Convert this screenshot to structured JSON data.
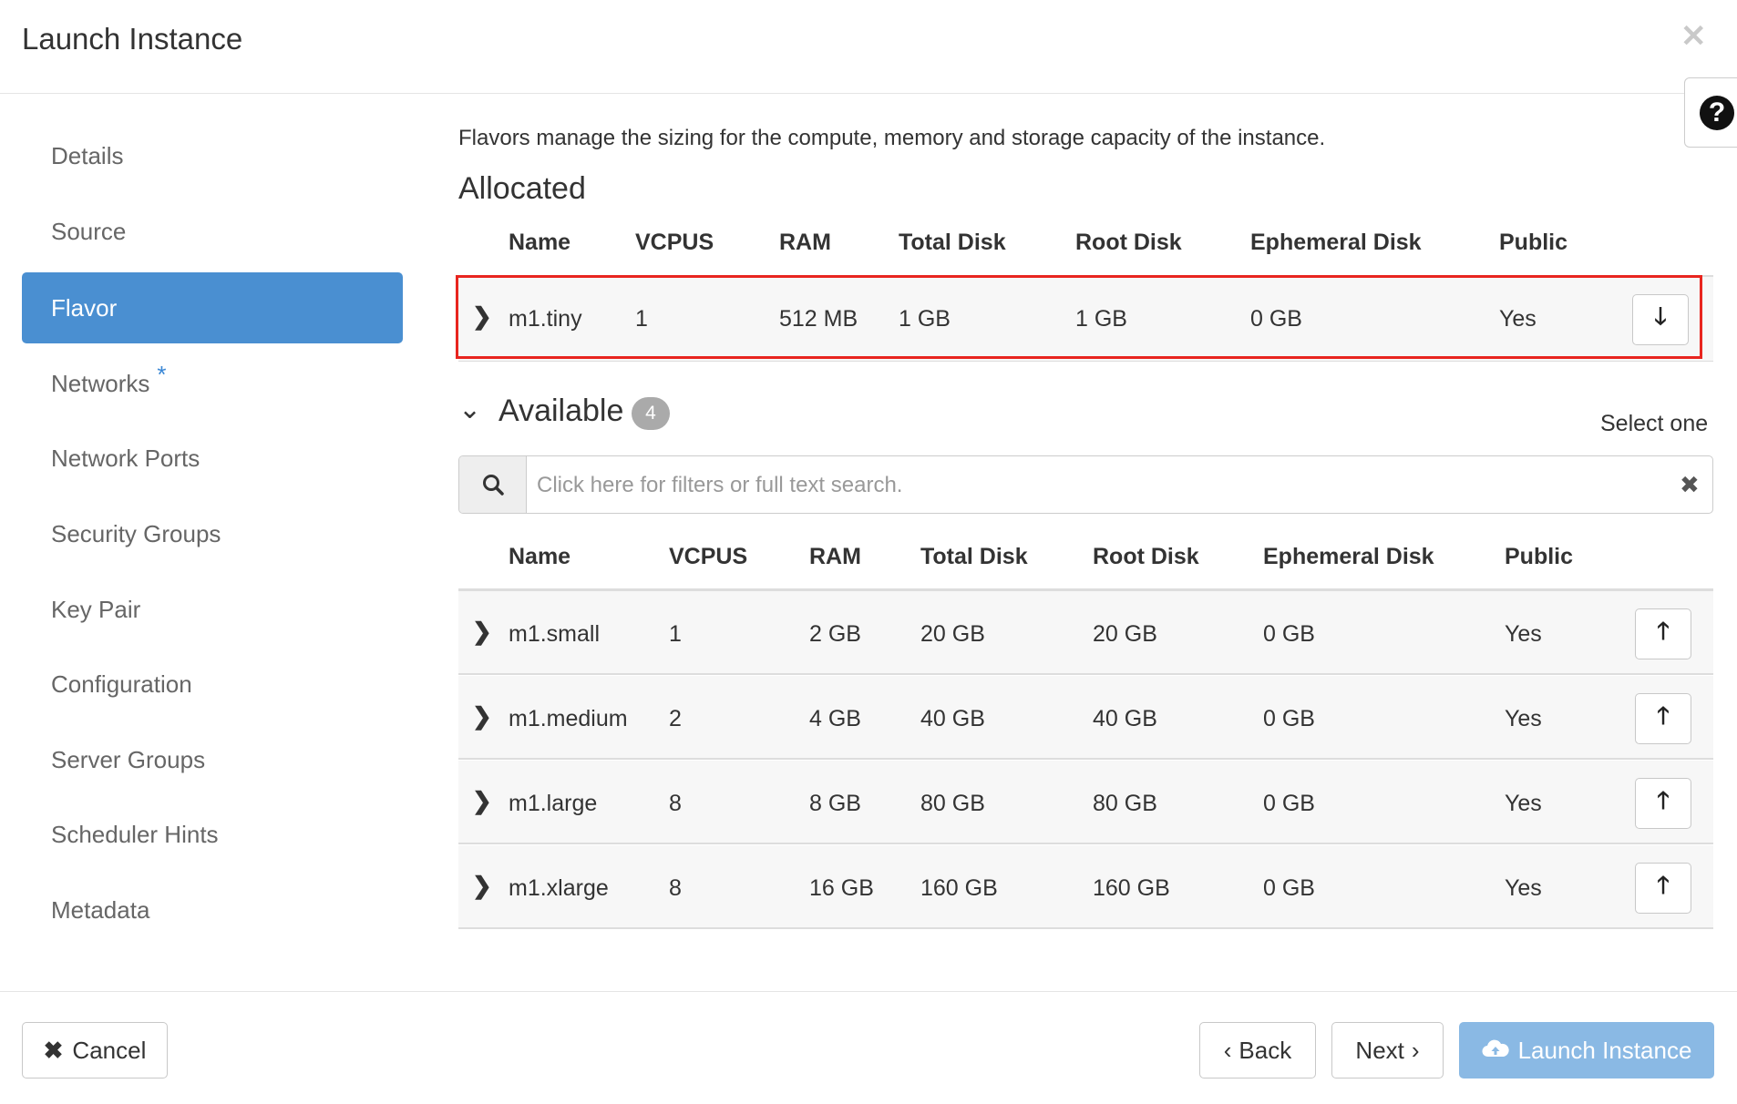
{
  "dialog": {
    "title": "Launch Instance",
    "close_icon": "close-icon",
    "help_label": "?"
  },
  "sidebar": {
    "items": [
      {
        "label": "Details"
      },
      {
        "label": "Source"
      },
      {
        "label": "Flavor",
        "active": true
      },
      {
        "label": "Networks",
        "required_mark": "*"
      },
      {
        "label": "Network Ports"
      },
      {
        "label": "Security Groups"
      },
      {
        "label": "Key Pair"
      },
      {
        "label": "Configuration"
      },
      {
        "label": "Server Groups"
      },
      {
        "label": "Scheduler Hints"
      },
      {
        "label": "Metadata"
      }
    ]
  },
  "main": {
    "intro": "Flavors manage the sizing for the compute, memory and storage capacity of the instance.",
    "allocated": {
      "heading": "Allocated",
      "columns": [
        "Name",
        "VCPUS",
        "RAM",
        "Total Disk",
        "Root Disk",
        "Ephemeral Disk",
        "Public"
      ],
      "rows": [
        {
          "name": "m1.tiny",
          "vcpus": "1",
          "ram": "512 MB",
          "total_disk": "1 GB",
          "root_disk": "1 GB",
          "ephemeral_disk": "0 GB",
          "public": "Yes"
        }
      ]
    },
    "available": {
      "heading": "Available",
      "count": "4",
      "select_hint": "Select one",
      "search_placeholder": "Click here for filters or full text search.",
      "columns": [
        "Name",
        "VCPUS",
        "RAM",
        "Total Disk",
        "Root Disk",
        "Ephemeral Disk",
        "Public"
      ],
      "rows": [
        {
          "name": "m1.small",
          "vcpus": "1",
          "ram": "2 GB",
          "total_disk": "20 GB",
          "root_disk": "20 GB",
          "ephemeral_disk": "0 GB",
          "public": "Yes"
        },
        {
          "name": "m1.medium",
          "vcpus": "2",
          "ram": "4 GB",
          "total_disk": "40 GB",
          "root_disk": "40 GB",
          "ephemeral_disk": "0 GB",
          "public": "Yes"
        },
        {
          "name": "m1.large",
          "vcpus": "8",
          "ram": "8 GB",
          "total_disk": "80 GB",
          "root_disk": "80 GB",
          "ephemeral_disk": "0 GB",
          "public": "Yes"
        },
        {
          "name": "m1.xlarge",
          "vcpus": "8",
          "ram": "16 GB",
          "total_disk": "160 GB",
          "root_disk": "160 GB",
          "ephemeral_disk": "0 GB",
          "public": "Yes"
        }
      ]
    }
  },
  "footer": {
    "cancel_label": "Cancel",
    "back_label": "Back",
    "next_label": "Next",
    "launch_label": "Launch Instance"
  },
  "colors": {
    "accent": "#4a8fd1",
    "launch_button": "#8ab9e4",
    "highlight_border": "#e8251f",
    "badge": "#aaaaaa"
  }
}
